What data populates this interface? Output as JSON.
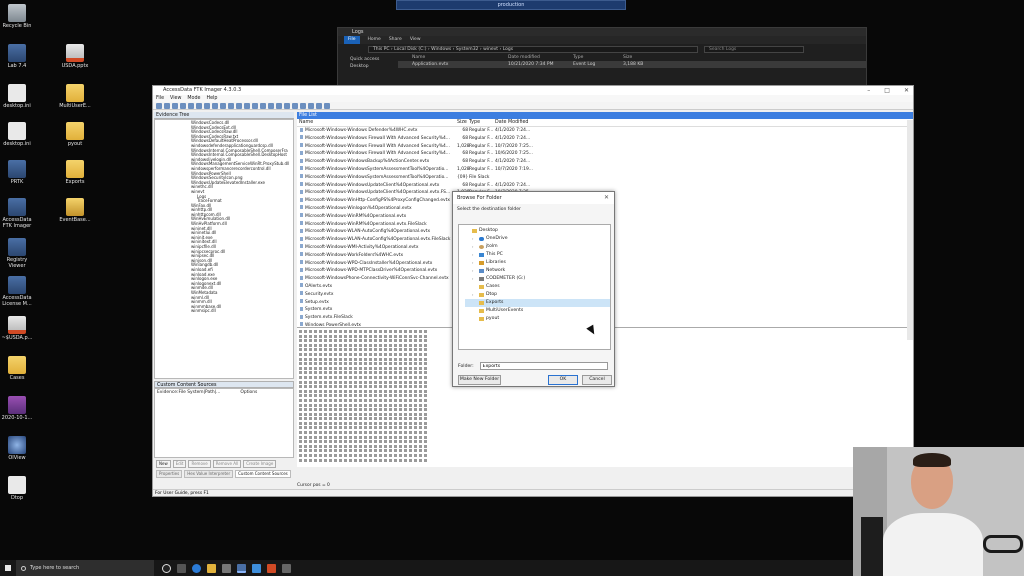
{
  "remote_bar": {
    "title": "production"
  },
  "desktop_icons": [
    {
      "label": "Recycle Bin",
      "icon": "recycle-bin-icon"
    },
    {
      "label": "Lab 7.4",
      "icon": "app-icon"
    },
    {
      "label": "USDA.pptx",
      "icon": "ppt-icon"
    },
    {
      "label": "desktop.ini",
      "icon": "doc-icon"
    },
    {
      "label": "MultiUserE...",
      "icon": "folder-icon"
    },
    {
      "label": "desktop.ini",
      "icon": "doc-icon"
    },
    {
      "label": "pyout",
      "icon": "folder-icon"
    },
    {
      "label": "PRTK",
      "icon": "app-icon"
    },
    {
      "label": "Exports",
      "icon": "folder-icon"
    },
    {
      "label": "AccessData FTK Imager",
      "icon": "app-icon"
    },
    {
      "label": "EventBase...",
      "icon": "zip-icon"
    },
    {
      "label": "Registry Viewer",
      "icon": "app-icon"
    },
    {
      "label": "AccessData License M...",
      "icon": "app-icon"
    },
    {
      "label": "~$USDA.p...",
      "icon": "ppt-icon"
    },
    {
      "label": "Cases",
      "icon": "folder-icon"
    },
    {
      "label": "2020-10-1...",
      "icon": "rar-icon"
    },
    {
      "label": "OIView",
      "icon": "round-app-icon"
    },
    {
      "label": "Dtop",
      "icon": "doc-icon"
    }
  ],
  "explorer": {
    "title": "Logs",
    "ribbon": [
      "File",
      "Home",
      "Share",
      "View"
    ],
    "path": "This PC  ›  Local Disk (C:)  ›  Windows  ›  System32  ›  winevt  ›  Logs",
    "search_placeholder": "Search Logs",
    "nav": [
      "Quick access",
      "Desktop"
    ],
    "columns": [
      "Name",
      "Date modified",
      "Type",
      "Size"
    ],
    "rows": [
      {
        "name": "Application.evtx",
        "date": "10/21/2020 7:34 PM",
        "type": "Event Log",
        "size": "3,188 KB"
      }
    ]
  },
  "ftk": {
    "title": "AccessData FTK Imager 4.3.0.3",
    "menu": [
      "File",
      "View",
      "Mode",
      "Help"
    ],
    "evidence_tree_label": "Evidence Tree",
    "tree": [
      "WindowsCodecs.dll",
      "WindowsCodecsExt.dll",
      "WindowsCodecsRaw.dll",
      "WindowsCodecsRaw.txt",
      "WindowsDefaultHeatProcessor.dll",
      "windowsdefenderapplicationguardcsp.dll",
      "WindowsInternal.ComposableShell.ComposerFra",
      "WindowsInternal.ComposableShell.DesktopHost",
      "windowslivelogin.dll",
      "WindowsManagementServiceWinRt.ProxyStub.dll",
      "windowsperformancerecordercontrol.dll",
      "WindowsPowerShell",
      "WindowsSecurityIcon.png",
      "WindowsUpdateElevatedInstaller.exe",
      "winethc.dll",
      "winevt",
      "Logs",
      "TraceFormat",
      "WinFax.dll",
      "winhttp.dll",
      "winhttpcom.dll",
      "WinHvEmulation.dll",
      "WinHvPlatform.dll",
      "wininet.dll",
      "wininetlui.dll",
      "wininit.exe",
      "wininitext.dll",
      "winipcfile.dll",
      "winipcsecproc.dll",
      "winipsec.dll",
      "winjson.dll",
      "Winlangdb.dll",
      "winload.efi",
      "winload.exe",
      "winlogon.exe",
      "winlogonext.dll",
      "winmde.dll",
      "WinMetadata",
      "winml.dll",
      "winmm.dll",
      "winmmbase.dll",
      "winmsipc.dll"
    ],
    "custom_sources_label": "Custom Content Sources",
    "custom_cols": [
      "Evidence:File System|Path|...",
      "Options"
    ],
    "custom_buttons": [
      "New",
      "Edit",
      "Remove",
      "Remove All",
      "Create Image"
    ],
    "left_tabs": [
      "Properties",
      "Hex Value Interpreter",
      "Custom Content Sources"
    ],
    "file_list_label": "File List",
    "columns": [
      "Name",
      "Size",
      "Type",
      "Date Modified"
    ],
    "files": [
      {
        "name": "Microsoft-Windows-Windows Defender%4WHC.evtx",
        "size": "68",
        "type": "Regular F...",
        "date": "4/1/2020 7:24..."
      },
      {
        "name": "Microsoft-Windows-Windows Firewall With Advanced Security%4...",
        "size": "68",
        "type": "Regular F...",
        "date": "4/1/2020 7:24..."
      },
      {
        "name": "Microsoft-Windows-Windows Firewall With Advanced Security%4...",
        "size": "1,028",
        "type": "Regular F...",
        "date": "10/7/2020 7:25..."
      },
      {
        "name": "Microsoft-Windows-Windows Firewall With Advanced Security%4...",
        "size": "68",
        "type": "Regular F...",
        "date": "10/6/2020 7:25..."
      },
      {
        "name": "Microsoft-Windows-WindowsBackup%4ActionCenter.evtx",
        "size": "68",
        "type": "Regular F...",
        "date": "4/1/2020 7:24..."
      },
      {
        "name": "Microsoft-Windows-WindowsSystemAssessmentTool%4Operatio...",
        "size": "1,028",
        "type": "Regular F...",
        "date": "10/7/2020 7:19..."
      },
      {
        "name": "Microsoft-Windows-WindowsSystemAssessmentTool%4Operatio...",
        "size": "{09}",
        "type": "File Slack",
        "date": ""
      },
      {
        "name": "Microsoft-Windows-WindowsUpdateClient%4Operational.evtx",
        "size": "68",
        "type": "Regular F...",
        "date": "4/1/2020 7:24..."
      },
      {
        "name": "Microsoft-Windows-WindowsUpdateClient%4Operational.evtx.FS...",
        "size": "1,028",
        "type": "Regular F...",
        "date": "10/7/2020 7:25..."
      },
      {
        "name": "Microsoft-Windows-WinHttp-ConfigPS%4ProxyConfigChanged.evtx",
        "size": "",
        "type": "",
        "date": ""
      },
      {
        "name": "Microsoft-Windows-Winlogon%4Operational.evtx",
        "size": "",
        "type": "",
        "date": ""
      },
      {
        "name": "Microsoft-Windows-WinRM%4Operational.evtx",
        "size": "",
        "type": "",
        "date": ""
      },
      {
        "name": "Microsoft-Windows-WinRM%4Operational.evtx.FileSlack",
        "size": "",
        "type": "",
        "date": ""
      },
      {
        "name": "Microsoft-Windows-WLAN-AutoConfig%4Operational.evtx",
        "size": "",
        "type": "",
        "date": ""
      },
      {
        "name": "Microsoft-Windows-WLAN-AutoConfig%4Operational.evtx.FileSlack",
        "size": "",
        "type": "",
        "date": ""
      },
      {
        "name": "Microsoft-Windows-WMI-Activity%4Operational.evtx",
        "size": "",
        "type": "",
        "date": ""
      },
      {
        "name": "Microsoft-Windows-WorkFolders%4WHC.evtx",
        "size": "",
        "type": "",
        "date": ""
      },
      {
        "name": "Microsoft-Windows-WPD-ClassInstaller%4Operational.evtx",
        "size": "",
        "type": "",
        "date": ""
      },
      {
        "name": "Microsoft-Windows-WPD-MTPClassDriver%4Operational.evtx",
        "size": "",
        "type": "",
        "date": ""
      },
      {
        "name": "Microsoft-WindowsPhone-Connectivity-WiFiConnSvc-Channel.evtx",
        "size": "",
        "type": "",
        "date": ""
      },
      {
        "name": "OAlerts.evtx",
        "size": "",
        "type": "",
        "date": ""
      },
      {
        "name": "Security.evtx",
        "size": "",
        "type": "",
        "date": ""
      },
      {
        "name": "Setup.evtx",
        "size": "",
        "type": "",
        "date": ""
      },
      {
        "name": "System.evtx",
        "size": "",
        "type": "",
        "date": ""
      },
      {
        "name": "System.evtx.FileSlack",
        "size": "",
        "type": "",
        "date": ""
      },
      {
        "name": "Windows PowerShell.evtx",
        "size": "",
        "type": "",
        "date": ""
      }
    ],
    "cursor_pos": "Cursor pos = 0",
    "status_help": "For User Guide, press F1"
  },
  "dialog": {
    "title": "Browse For Folder",
    "subtitle": "Select the destination folder",
    "tree": [
      {
        "label": "Desktop",
        "icon": "folder",
        "level": 0,
        "arrow": ""
      },
      {
        "label": "OneDrive",
        "icon": "cloud",
        "level": 1,
        "arrow": "›"
      },
      {
        "label": "jtolm",
        "icon": "user",
        "level": 1,
        "arrow": "›"
      },
      {
        "label": "This PC",
        "icon": "pc",
        "level": 1,
        "arrow": "›"
      },
      {
        "label": "Libraries",
        "icon": "lib",
        "level": 1,
        "arrow": "›"
      },
      {
        "label": "Network",
        "icon": "net",
        "level": 1,
        "arrow": "›"
      },
      {
        "label": "CODEMETER (G:)",
        "icon": "drive",
        "level": 1,
        "arrow": "›"
      },
      {
        "label": "Cases",
        "icon": "folder",
        "level": 1,
        "arrow": ""
      },
      {
        "label": "Dtop",
        "icon": "folder",
        "level": 1,
        "arrow": "›"
      },
      {
        "label": "Exports",
        "icon": "folder",
        "level": 1,
        "arrow": ""
      },
      {
        "label": "MultiUserEvents",
        "icon": "folder",
        "level": 1,
        "arrow": ""
      },
      {
        "label": "pyout",
        "icon": "folder",
        "level": 1,
        "arrow": ""
      }
    ],
    "selected_index": 9,
    "folder_label": "Folder:",
    "folder_value": "Exports",
    "make_new_folder": "Make New Folder",
    "ok": "OK",
    "cancel": "Cancel"
  },
  "taskbar": {
    "search_placeholder": "Type here to search"
  }
}
